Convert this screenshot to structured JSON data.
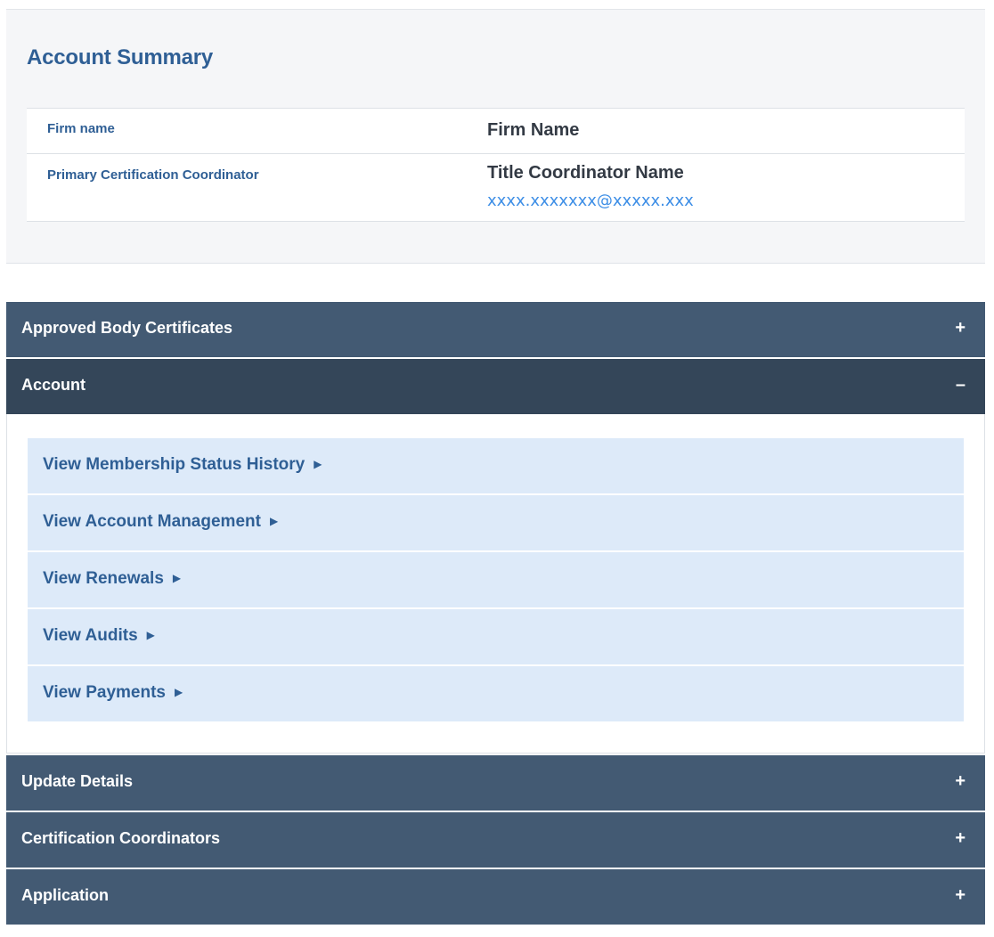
{
  "account_summary": {
    "title": "Account Summary",
    "rows": [
      {
        "label": "Firm name",
        "value": "Firm Name"
      },
      {
        "label": "Primary Certification Coordinator",
        "value": "Title Coordinator Name",
        "email": "xxxx.xxxxxxx@xxxxx.xxx"
      }
    ]
  },
  "accordion": {
    "sections": [
      {
        "label": "Approved Body Certificates",
        "toggle": "+"
      },
      {
        "label": "Account",
        "toggle": "–"
      },
      {
        "label": "Update Details",
        "toggle": "+"
      },
      {
        "label": "Certification Coordinators",
        "toggle": "+"
      },
      {
        "label": "Application",
        "toggle": "+"
      }
    ],
    "account_links": [
      {
        "label": "View Membership Status History",
        "arrow": "▶"
      },
      {
        "label": "View Account Management",
        "arrow": "▶"
      },
      {
        "label": "View Renewals",
        "arrow": "▶"
      },
      {
        "label": "View Audits",
        "arrow": "▶"
      },
      {
        "label": "View Payments",
        "arrow": "▶"
      }
    ]
  },
  "colors": {
    "header_bg": "#435a73",
    "header_open_bg": "#344659",
    "link_bg": "#ddeaf9",
    "accent_text": "#2f5f95",
    "email_link": "#3d8ee6"
  }
}
